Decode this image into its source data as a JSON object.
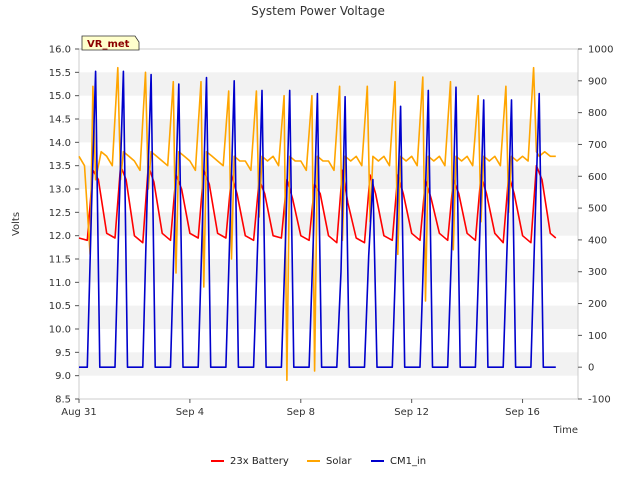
{
  "chart_data": {
    "type": "line",
    "title": "System Power Voltage",
    "badge": "VR_met",
    "xlabel": "Time",
    "ylabel": "Volts",
    "x_ticks": [
      "Aug 31",
      "Sep 4",
      "Sep 8",
      "Sep 12",
      "Sep 16"
    ],
    "x_tick_days": [
      0,
      4,
      8,
      12,
      16
    ],
    "xlim_days": [
      0,
      18
    ],
    "y_left_ticks": [
      "8.5",
      "9.0",
      "9.5",
      "10.0",
      "10.5",
      "11.0",
      "11.5",
      "12.0",
      "12.5",
      "13.0",
      "13.5",
      "14.0",
      "14.5",
      "15.0",
      "15.5",
      "16.0"
    ],
    "ylim_left": [
      8.5,
      16.0
    ],
    "y_right_ticks": [
      "-100",
      "0",
      "100",
      "200",
      "300",
      "400",
      "500",
      "600",
      "700",
      "800",
      "900",
      "1000"
    ],
    "ylim_right": [
      -100,
      1000
    ],
    "grid": "horizontal bands",
    "legend_position": "bottom",
    "colors": {
      "battery": "#ff0000",
      "solar": "#ffa500",
      "cm1": "#0000cc",
      "band": "#f2f2f2",
      "badge_bg": "#ffffcc"
    },
    "series": [
      {
        "name": "23x Battery",
        "axis": "left",
        "color": "#ff0000",
        "x_days": [
          0.0,
          0.3,
          0.5,
          0.7,
          1.0,
          1.3,
          1.5,
          1.7,
          2.0,
          2.3,
          2.5,
          2.7,
          3.0,
          3.3,
          3.5,
          3.7,
          4.0,
          4.3,
          4.5,
          4.7,
          5.0,
          5.3,
          5.5,
          5.7,
          6.0,
          6.3,
          6.5,
          6.7,
          7.0,
          7.3,
          7.5,
          7.7,
          8.0,
          8.3,
          8.5,
          8.7,
          9.0,
          9.3,
          9.5,
          9.7,
          10.0,
          10.3,
          10.5,
          10.7,
          11.0,
          11.3,
          11.5,
          11.7,
          12.0,
          12.3,
          12.5,
          12.7,
          13.0,
          13.3,
          13.5,
          13.7,
          14.0,
          14.3,
          14.5,
          14.7,
          15.0,
          15.3,
          15.5,
          15.7,
          16.0,
          16.3,
          16.5,
          16.7,
          17.0,
          17.2
        ],
        "values": [
          11.95,
          11.9,
          13.4,
          13.2,
          12.05,
          11.95,
          13.5,
          13.2,
          12.0,
          11.85,
          13.5,
          13.15,
          12.05,
          11.9,
          13.3,
          13.0,
          12.05,
          11.95,
          13.4,
          13.1,
          12.05,
          11.95,
          13.3,
          12.9,
          12.0,
          11.9,
          13.2,
          12.9,
          12.0,
          11.95,
          13.2,
          12.8,
          12.0,
          11.9,
          13.1,
          12.9,
          12.0,
          11.85,
          13.4,
          12.7,
          11.95,
          11.85,
          13.3,
          12.9,
          12.0,
          11.9,
          13.3,
          12.9,
          12.05,
          11.9,
          13.2,
          12.8,
          12.05,
          11.9,
          13.2,
          12.9,
          12.05,
          11.9,
          13.3,
          12.9,
          12.05,
          11.85,
          13.3,
          12.9,
          12.0,
          11.85,
          13.5,
          13.2,
          12.05,
          11.95
        ]
      },
      {
        "name": "Solar",
        "axis": "left",
        "color": "#ffa500",
        "x_days": [
          0.0,
          0.2,
          0.4,
          0.5,
          0.6,
          0.8,
          1.0,
          1.2,
          1.4,
          1.5,
          1.6,
          1.8,
          2.0,
          2.2,
          2.4,
          2.5,
          2.6,
          2.8,
          3.0,
          3.2,
          3.4,
          3.5,
          3.6,
          3.8,
          4.0,
          4.2,
          4.4,
          4.5,
          4.6,
          4.8,
          5.0,
          5.2,
          5.4,
          5.5,
          5.6,
          5.8,
          6.0,
          6.2,
          6.4,
          6.5,
          6.6,
          6.8,
          7.0,
          7.2,
          7.4,
          7.5,
          7.6,
          7.8,
          8.0,
          8.2,
          8.4,
          8.5,
          8.6,
          8.8,
          9.0,
          9.2,
          9.4,
          9.5,
          9.6,
          9.8,
          10.0,
          10.2,
          10.4,
          10.5,
          10.6,
          10.8,
          11.0,
          11.2,
          11.4,
          11.5,
          11.6,
          11.8,
          12.0,
          12.2,
          12.4,
          12.5,
          12.6,
          12.8,
          13.0,
          13.2,
          13.4,
          13.5,
          13.6,
          13.8,
          14.0,
          14.2,
          14.4,
          14.5,
          14.6,
          14.8,
          15.0,
          15.2,
          15.4,
          15.5,
          15.6,
          15.8,
          16.0,
          16.2,
          16.4,
          16.5,
          16.6,
          16.8,
          17.0,
          17.2
        ],
        "values": [
          13.7,
          13.5,
          11.6,
          15.2,
          13.2,
          13.8,
          13.7,
          13.5,
          15.6,
          13.2,
          13.8,
          13.7,
          13.6,
          13.4,
          15.5,
          13.0,
          13.8,
          13.7,
          13.6,
          13.5,
          15.3,
          11.2,
          13.8,
          13.7,
          13.6,
          13.4,
          15.3,
          10.9,
          13.8,
          13.7,
          13.6,
          13.5,
          15.1,
          11.5,
          13.7,
          13.6,
          13.6,
          13.4,
          15.1,
          12.4,
          13.7,
          13.6,
          13.7,
          13.5,
          15.0,
          8.9,
          13.7,
          13.6,
          13.6,
          13.4,
          15.0,
          9.1,
          13.7,
          13.6,
          13.6,
          13.4,
          15.2,
          11.9,
          13.7,
          13.6,
          13.7,
          13.5,
          15.2,
          12.3,
          13.7,
          13.6,
          13.7,
          13.5,
          15.3,
          11.6,
          13.7,
          13.6,
          13.7,
          13.5,
          15.4,
          10.6,
          13.7,
          13.6,
          13.7,
          13.5,
          15.3,
          11.7,
          13.7,
          13.6,
          13.7,
          13.5,
          15.0,
          12.3,
          13.7,
          13.6,
          13.7,
          13.5,
          15.2,
          12.5,
          13.7,
          13.6,
          13.7,
          13.6,
          15.6,
          13.8,
          13.7,
          13.8,
          13.7,
          13.7
        ]
      },
      {
        "name": "CM1_in",
        "axis": "right",
        "color": "#0000cc",
        "x_days": [
          0.0,
          0.3,
          0.45,
          0.6,
          0.75,
          1.0,
          1.3,
          1.45,
          1.6,
          1.75,
          2.0,
          2.3,
          2.45,
          2.6,
          2.75,
          3.0,
          3.3,
          3.45,
          3.6,
          3.75,
          4.0,
          4.3,
          4.45,
          4.6,
          4.75,
          5.0,
          5.3,
          5.45,
          5.6,
          5.75,
          6.0,
          6.3,
          6.45,
          6.6,
          6.75,
          7.0,
          7.3,
          7.45,
          7.6,
          7.75,
          8.0,
          8.3,
          8.45,
          8.6,
          8.75,
          9.0,
          9.3,
          9.45,
          9.6,
          9.75,
          10.0,
          10.3,
          10.45,
          10.6,
          10.75,
          11.0,
          11.3,
          11.45,
          11.6,
          11.75,
          12.0,
          12.3,
          12.45,
          12.6,
          12.75,
          13.0,
          13.3,
          13.45,
          13.6,
          13.75,
          14.0,
          14.3,
          14.45,
          14.6,
          14.75,
          15.0,
          15.3,
          15.45,
          15.6,
          15.75,
          16.0,
          16.3,
          16.45,
          16.6,
          16.75,
          17.0,
          17.2
        ],
        "values": [
          0,
          0,
          500,
          930,
          0,
          0,
          0,
          500,
          930,
          0,
          0,
          0,
          500,
          920,
          0,
          0,
          0,
          450,
          890,
          0,
          0,
          0,
          450,
          910,
          0,
          0,
          0,
          450,
          900,
          0,
          0,
          0,
          400,
          870,
          0,
          0,
          0,
          400,
          870,
          0,
          0,
          0,
          400,
          860,
          0,
          0,
          0,
          300,
          850,
          0,
          0,
          0,
          350,
          590,
          0,
          0,
          0,
          400,
          820,
          0,
          0,
          0,
          400,
          870,
          0,
          0,
          0,
          400,
          880,
          0,
          0,
          0,
          400,
          840,
          0,
          0,
          0,
          400,
          840,
          0,
          0,
          0,
          450,
          860,
          0,
          0,
          0
        ]
      }
    ]
  }
}
